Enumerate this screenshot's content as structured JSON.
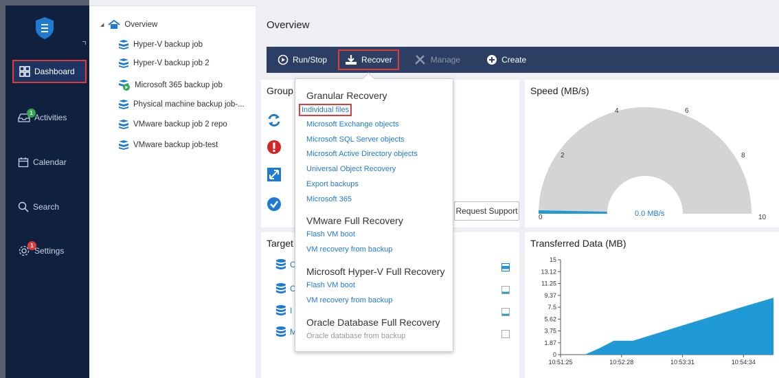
{
  "nav": {
    "items": [
      {
        "label": "Dashboard"
      },
      {
        "label": "Activities",
        "badge": "1"
      },
      {
        "label": "Calendar"
      },
      {
        "label": "Search"
      },
      {
        "label": "Settings",
        "badge": "1"
      }
    ]
  },
  "tree": {
    "root": "Overview",
    "items": [
      {
        "label": "Hyper-V backup job"
      },
      {
        "label": "Hyper-V backup job 2"
      },
      {
        "label": "Microsoft 365 backup job"
      },
      {
        "label": "Physical machine backup job-..."
      },
      {
        "label": "VMware backup job 2 repo"
      },
      {
        "label": "VMware backup job-test"
      }
    ]
  },
  "main": {
    "title": "Overview",
    "toolbar": {
      "run_stop": "Run/Stop",
      "recover": "Recover",
      "manage": "Manage",
      "create": "Create"
    },
    "group_panel": {
      "title": "Group",
      "request_support": "Request Support"
    },
    "target_panel": {
      "title": "Target",
      "row_letters": [
        "C",
        "C",
        "I",
        "M"
      ]
    },
    "speed_panel": {
      "title": "Speed (MB/s)",
      "gauge_labels": [
        "0",
        "2",
        "4",
        "6",
        "8",
        "10"
      ],
      "value_text": "0.0 MB/s"
    },
    "transferred_panel": {
      "title": "Transferred Data (MB)"
    }
  },
  "dropdown": {
    "sections": [
      {
        "title": "Granular Recovery",
        "items": [
          "Individual files",
          "Microsoft Exchange objects",
          "Microsoft SQL Server objects",
          "Microsoft Active Directory objects",
          "Universal Object Recovery",
          "Export backups",
          "Microsoft 365"
        ]
      },
      {
        "title": "VMware Full Recovery",
        "items": [
          "Flash VM boot",
          "VM recovery from backup"
        ]
      },
      {
        "title": "Microsoft Hyper-V Full Recovery",
        "items": [
          "Flash VM boot",
          "VM recovery from backup"
        ]
      },
      {
        "title": "Oracle Database Full Recovery",
        "items": [
          "Oracle database from backup"
        ]
      }
    ]
  },
  "chart_data": {
    "type": "area",
    "title": "Transferred Data (MB)",
    "x": [
      "10:51:25",
      "10:52:28",
      "10:53:31",
      "10:54:34"
    ],
    "y_ticks": [
      "0",
      "1.87",
      "3.75",
      "5.62",
      "7.5",
      "9.37",
      "11.25",
      "13.12",
      "15"
    ],
    "ylim": [
      0,
      15
    ],
    "series": [
      {
        "values_by_time": [
          {
            "t": "10:51:25",
            "v": 0
          },
          {
            "t": "10:51:50",
            "v": 0
          },
          {
            "t": "10:52:05",
            "v": 1
          },
          {
            "t": "10:52:20",
            "v": 2.2
          },
          {
            "t": "10:52:40",
            "v": 2.2
          },
          {
            "t": "10:54:34",
            "v": 7.6
          },
          {
            "t": "10:55:05",
            "v": 9
          }
        ]
      }
    ],
    "accent": "#1f9ad6"
  }
}
